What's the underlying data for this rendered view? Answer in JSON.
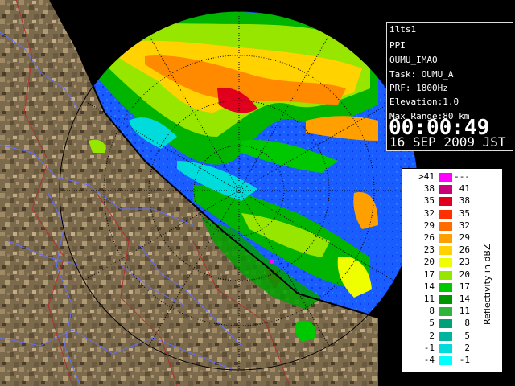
{
  "info": {
    "site": "ilts1",
    "mode": "PPI",
    "product": "OUMU_IMAO",
    "task": "Task: OUMU_A",
    "prf": "PRF: 1800Hz",
    "elevation": "Elevation:1.0",
    "max_range": "Max Range:80 km",
    "clock": "00:00:49",
    "date": "16 SEP 2009 JST"
  },
  "legend": {
    "title": "Reflectivity in dBZ",
    "rows": [
      {
        "low": ">41",
        "high": "---",
        "color": "#ff00ff"
      },
      {
        "low": "38",
        "high": "41",
        "color": "#c8007a"
      },
      {
        "low": "35",
        "high": "38",
        "color": "#e0001e"
      },
      {
        "low": "32",
        "high": "35",
        "color": "#ff2f00"
      },
      {
        "low": "29",
        "high": "32",
        "color": "#ff6c00"
      },
      {
        "low": "26",
        "high": "29",
        "color": "#ffa000"
      },
      {
        "low": "23",
        "high": "26",
        "color": "#ffd200"
      },
      {
        "low": "20",
        "high": "23",
        "color": "#f0ff00"
      },
      {
        "low": "17",
        "high": "20",
        "color": "#96e600"
      },
      {
        "low": "14",
        "high": "17",
        "color": "#00c800"
      },
      {
        "low": "11",
        "high": "14",
        "color": "#009600"
      },
      {
        "low": "8",
        "high": "11",
        "color": "#32b43c"
      },
      {
        "low": "5",
        "high": "8",
        "color": "#00a078"
      },
      {
        "low": "2",
        "high": "5",
        "color": "#00b4a0"
      },
      {
        "low": "-1",
        "high": "2",
        "color": "#00dcdc"
      },
      {
        "low": "-4",
        "high": "-1",
        "color": "#00ffff"
      }
    ]
  },
  "colors": {
    "background": "#000000",
    "sea": "#1460ff",
    "sea_dark": "#0000c8",
    "land": "#8a7656",
    "rivers": "#6070ff",
    "boundaries": "#b03030",
    "range_rings": "#000000"
  }
}
